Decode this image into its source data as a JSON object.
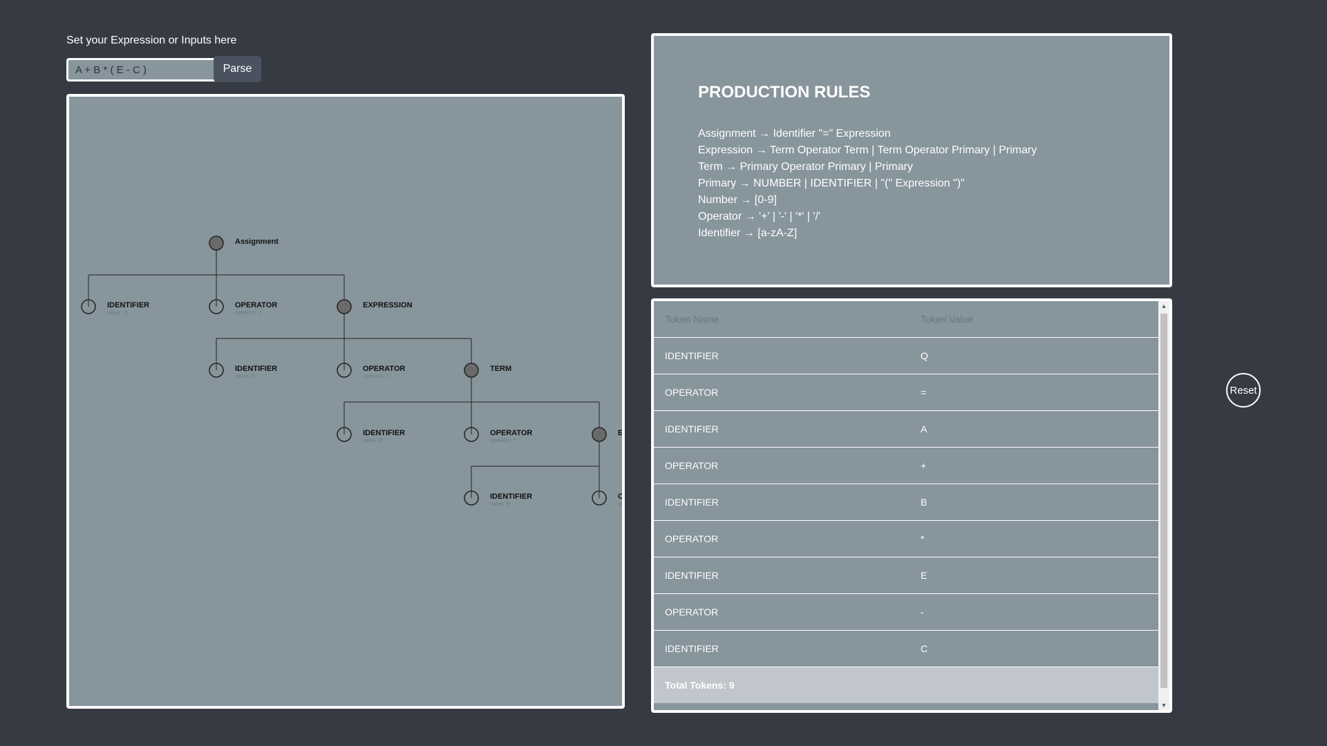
{
  "expression_section": {
    "label": "Set your Expression or Inputs here",
    "input_value": "A + B * ( E - C )",
    "parse_label": "Parse"
  },
  "tree": {
    "nodes": [
      {
        "id": "assignment",
        "label": "Assignment",
        "sub": "",
        "filled": true
      },
      {
        "id": "id-q",
        "label": "IDENTIFIER",
        "sub": "value: Q",
        "filled": false
      },
      {
        "id": "op-eq",
        "label": "OPERATOR",
        "sub": "operator: =",
        "filled": false
      },
      {
        "id": "expression",
        "label": "EXPRESSION",
        "sub": "",
        "filled": true
      },
      {
        "id": "id-a",
        "label": "IDENTIFIER",
        "sub": "value: A",
        "filled": false
      },
      {
        "id": "op-plus",
        "label": "OPERATOR",
        "sub": "operator: +",
        "filled": false
      },
      {
        "id": "term",
        "label": "TERM",
        "sub": "",
        "filled": true
      },
      {
        "id": "id-b",
        "label": "IDENTIFIER",
        "sub": "value: B",
        "filled": false
      },
      {
        "id": "op-mul",
        "label": "OPERATOR",
        "sub": "operator: *",
        "filled": false
      },
      {
        "id": "expression-2",
        "label": "EXPRESSION",
        "sub": "",
        "filled": true
      },
      {
        "id": "id-e",
        "label": "IDENTIFIER",
        "sub": "value: E",
        "filled": false
      },
      {
        "id": "op-minus",
        "label": "OPERATOR",
        "sub": "operator: -",
        "filled": false
      }
    ]
  },
  "rules": {
    "title": "PRODUCTION RULES",
    "items": [
      "Assignment → Identifier \"=\" Expression",
      "Expression → Term Operator Term | Term Operator Primary | Primary",
      "Term → Primary Operator Primary | Primary",
      "Primary → NUMBER | IDENTIFIER | \"(\" Expression \")\"",
      "Number → [0-9]",
      "Operator → '+' | '-' | '*' | '/'",
      "Identifier → [a-zA-Z]"
    ]
  },
  "tokens": {
    "header": {
      "name": "Token Name",
      "value": "Token Value"
    },
    "rows": [
      {
        "name": "IDENTIFIER",
        "value": "Q"
      },
      {
        "name": "OPERATOR",
        "value": "="
      },
      {
        "name": "IDENTIFIER",
        "value": "A"
      },
      {
        "name": "OPERATOR",
        "value": "+"
      },
      {
        "name": "IDENTIFIER",
        "value": "B"
      },
      {
        "name": "OPERATOR",
        "value": "*"
      },
      {
        "name": "IDENTIFIER",
        "value": "E"
      },
      {
        "name": "OPERATOR",
        "value": "-"
      },
      {
        "name": "IDENTIFIER",
        "value": "C"
      }
    ],
    "total_label": "Total Tokens: 9"
  },
  "reset_label": "Reset",
  "colors": {
    "background": "#363b43",
    "panel": "#87959c",
    "node_fill": "#6a6a6a",
    "line": "#222222"
  }
}
